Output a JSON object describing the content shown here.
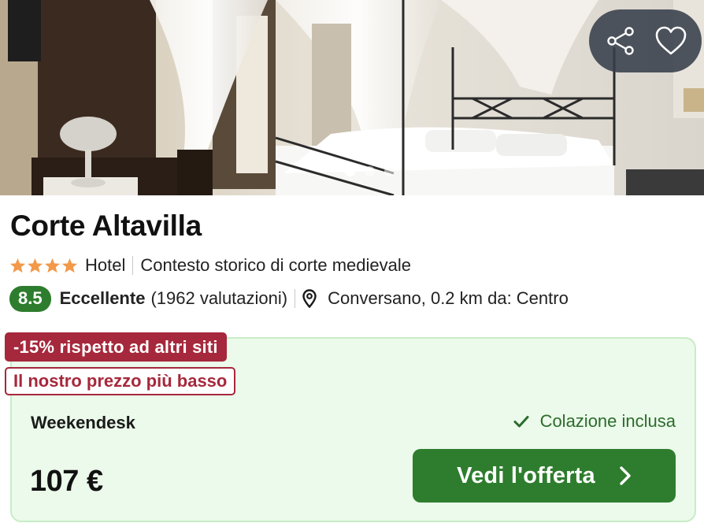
{
  "hotel": {
    "name": "Corte Altavilla",
    "star_rating": 4,
    "type": "Hotel",
    "tagline": "Contesto storico di corte medievale",
    "score": "8.5",
    "score_label": "Eccellente",
    "reviews": "(1962 valutazioni)",
    "location": "Conversano, 0.2 km da: Centro"
  },
  "gallery": {
    "image_count": 3,
    "active_index": 0
  },
  "actions": {
    "share_icon": "share-icon",
    "favorite_icon": "heart-icon"
  },
  "offer": {
    "discount_badge": "-15% rispetto ad altri siti",
    "lowest_badge": "Il nostro prezzo più basso",
    "provider": "Weekendesk",
    "amenity": "Colazione inclusa",
    "price": "107 €",
    "cta_label": "Vedi l'offerta"
  },
  "colors": {
    "score_green": "#2e7d2e",
    "badge_red": "#a6283c",
    "card_bg": "#ebfaea",
    "star_orange": "#f2994a"
  }
}
